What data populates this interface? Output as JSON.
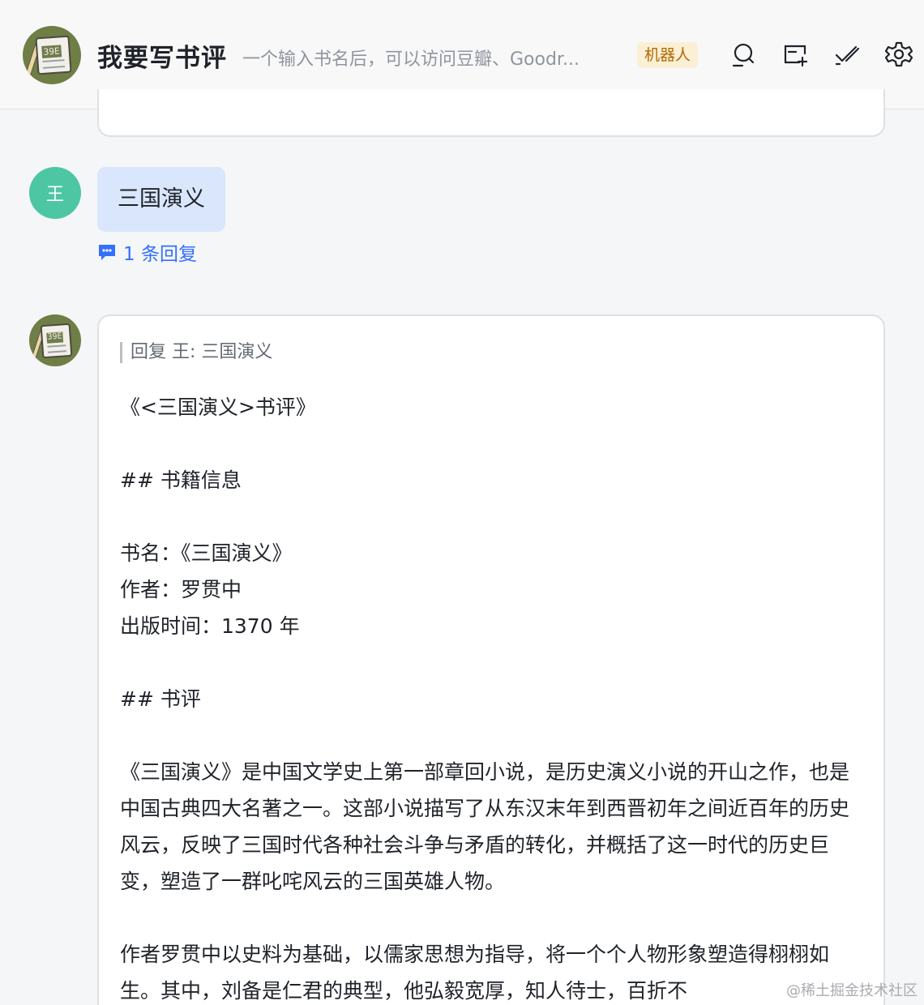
{
  "header": {
    "title": "我要写书评",
    "subtitle": "一个输入书名后，可以访问豆瓣、Goodr...",
    "badge": "机器人",
    "avatar_text": "39E",
    "icons": [
      "search-chat-icon",
      "add-screen-icon",
      "edit-check-icon",
      "settings-gear-icon"
    ]
  },
  "user_message": {
    "avatar": "王",
    "text": "三国演义",
    "reply_count_label": "1 条回复"
  },
  "bot_reply": {
    "avatar_text": "39E",
    "quote": "回复 王: 三国演义",
    "paragraphs": [
      "《<三国演义>书评》",
      "",
      "## 书籍信息",
      "",
      "书名：《三国演义》",
      "作者：罗贯中",
      "出版时间：1370 年",
      "",
      "## 书评",
      "",
      "《三国演义》是中国文学史上第一部章回小说，是历史演义小说的开山之作，也是中国古典四大名著之一。这部小说描写了从东汉末年到西晋初年之间近百年的历史风云，反映了三国时代各种社会斗争与矛盾的转化，并概括了这一时代的历史巨变，塑造了一群叱咤风云的三国英雄人物。",
      "",
      "作者罗贯中以史料为基础，以儒家思想为指导，将一个个人物形象塑造得栩栩如生。其中，刘备是仁君的典型，他弘毅宽厚，知人待士，百折不"
    ]
  },
  "watermark": "@稀土掘金技术社区",
  "colors": {
    "accent": "#3370ff",
    "user_bubble": "#d9e6fb",
    "user_avatar": "#4dc6a4",
    "badge_bg": "#fbefd6",
    "badge_text": "#b26a00"
  }
}
